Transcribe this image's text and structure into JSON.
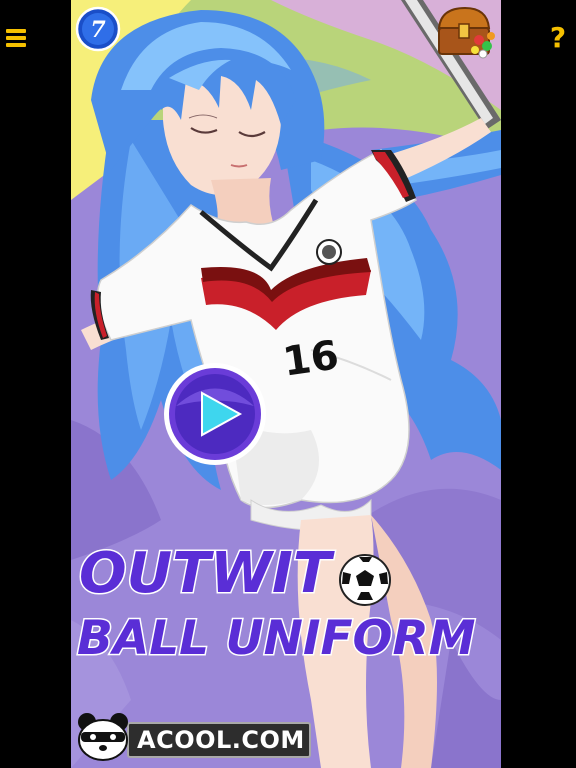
{
  "header": {
    "menu_icon": "hamburger-menu-icon",
    "help_icon": "question-mark-icon",
    "help_label": "?",
    "badge_label": "7",
    "chest_icon": "treasure-chest-icon"
  },
  "jersey": {
    "number": "16"
  },
  "play": {
    "icon": "play-triangle-icon"
  },
  "title": {
    "line1": "OUTWIT",
    "line2": "BALL UNIFORM"
  },
  "logo": {
    "text": "ACOOL.COM"
  },
  "colors": {
    "accent_yellow": "#f5c000",
    "title_fill": "#5a2ed6",
    "title_outline": "#ffffff",
    "play_ring": "#6a3cd8",
    "play_triangle": "#3ed6ee",
    "hair": "#4d8ee8",
    "bed": "#9b87d8"
  }
}
